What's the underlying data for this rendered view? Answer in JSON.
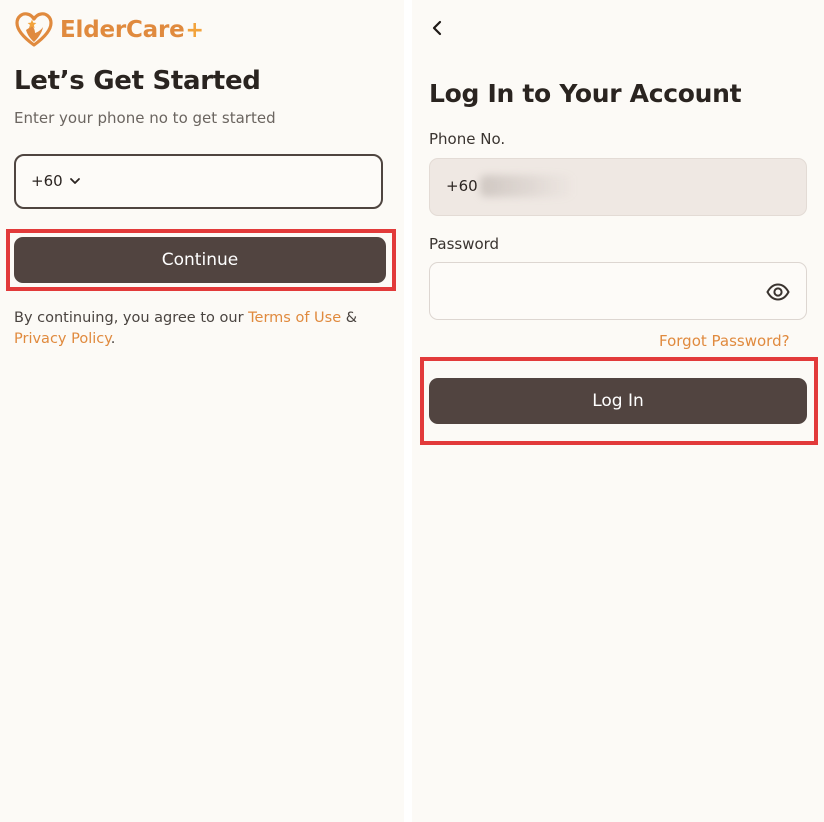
{
  "brand": {
    "name": "ElderCare",
    "plus": "+"
  },
  "start_screen": {
    "title": "Let’s Get Started",
    "subtitle": "Enter your phone no to get started",
    "country_code": "+60",
    "continue_label": "Continue",
    "legal": {
      "prefix": "By continuing, you agree to our ",
      "terms_label": "Terms of Use",
      "joiner": " & ",
      "privacy_label": "Privacy Policy",
      "suffix": "."
    }
  },
  "login_screen": {
    "title": "Log In to Your Account",
    "phone_label": "Phone No.",
    "phone_value": "+60",
    "password_label": "Password",
    "password_value": "",
    "forgot_label": "Forgot Password?",
    "login_label": "Log In"
  },
  "icons": {
    "logo": "heart-hands-logo-icon",
    "dropdown": "chevron-down-icon",
    "back": "chevron-left-icon",
    "visibility": "eye-icon"
  },
  "colors": {
    "background": "#fcfaf6",
    "brand_orange": "#e08a3e",
    "primary_button": "#514440",
    "highlight_red": "#e23a3a",
    "phone_field_fill": "#efe8e3"
  }
}
